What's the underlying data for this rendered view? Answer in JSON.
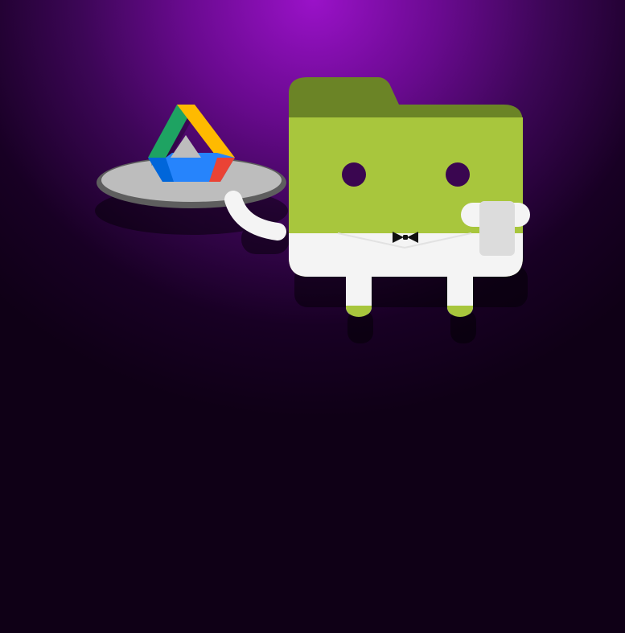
{
  "colors": {
    "background_top": "#9a12c8",
    "background_bottom": "#0f0016",
    "folder_body": "#a8c63d",
    "folder_tab": "#6b8426",
    "shirt": "#f4f4f4",
    "tray": "#bdbdbd",
    "tray_rim": "#5e5e5e",
    "drive_green": "#1ea362",
    "drive_yellow": "#ffba00",
    "drive_blue": "#2684fc",
    "drive_red": "#ea4335",
    "drive_dark_blue": "#0066da",
    "bow_tie": "#111111"
  },
  "illustration": {
    "mascot": "folder-waiter-mascot",
    "carried_item": "google-drive-logo"
  }
}
